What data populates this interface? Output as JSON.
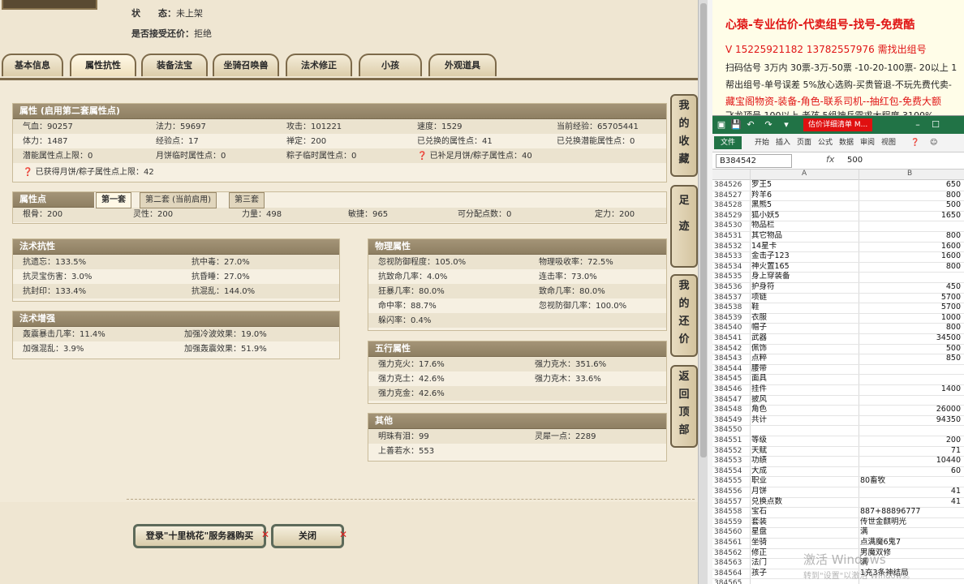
{
  "top": {
    "status_key": "状　　态：",
    "status_val": "未上架",
    "bargain_key": "是否接受还价：",
    "bargain_val": "拒绝"
  },
  "tabs": [
    "基本信息",
    "属性抗性",
    "装备法宝",
    "坐骑召唤兽",
    "法术修正",
    "小孩",
    "外观道具"
  ],
  "attr": {
    "title": "属性 (启用第二套属性点)",
    "rows": [
      [
        "气血：90257",
        "法力：59697",
        "攻击：101221",
        "速度：1529",
        "当前经验：65705441"
      ],
      [
        "体力：1487",
        "经验点：17",
        "禅定：200",
        "已兑换的属性点：41",
        "已兑换潜能属性点：0"
      ],
      [
        "潜能属性点上限：0",
        "月饼临时属性点：0",
        "粽子临时属性点：0",
        "已补足月饼/粽子属性点：40",
        ""
      ]
    ],
    "note": "已获得月饼/粽子属性点上限：42"
  },
  "points": {
    "title": "属性点",
    "subtabs": [
      "第一套",
      "第二套 (当前启用)",
      "第三套"
    ],
    "values": [
      "根骨：200",
      "灵性：200",
      "力量：498",
      "敏捷：965",
      "可分配点数：0",
      "定力：200"
    ]
  },
  "magic_resist": {
    "title": "法术抗性",
    "rows": [
      [
        "抗遗忘：133.5%",
        "抗中毒：27.0%"
      ],
      [
        "抗灵宝伤害：3.0%",
        "抗昏睡：27.0%"
      ],
      [
        "抗封印：133.4%",
        "抗混乱：144.0%"
      ]
    ]
  },
  "magic_boost": {
    "title": "法术增强",
    "rows": [
      [
        "轰震暴击几率：11.4%",
        "加强冷波效果：19.0%"
      ],
      [
        "加强混乱：3.9%",
        "加强轰震效果：51.9%"
      ]
    ]
  },
  "physical": {
    "title": "物理属性",
    "rows": [
      [
        "忽视防御程度：105.0%",
        "物理吸收率：72.5%"
      ],
      [
        "抗致命几率：4.0%",
        "连击率：73.0%"
      ],
      [
        "狂暴几率：80.0%",
        "致命几率：80.0%"
      ],
      [
        "命中率：88.7%",
        "忽视防御几率：100.0%"
      ],
      [
        "躲闪率：0.4%",
        ""
      ]
    ]
  },
  "wuxing": {
    "title": "五行属性",
    "rows": [
      [
        "强力克火：17.6%",
        "强力克水：351.6%"
      ],
      [
        "强力克土：42.6%",
        "强力克木：33.6%"
      ],
      [
        "强力克金：42.6%",
        ""
      ]
    ]
  },
  "other": {
    "title": "其他",
    "rows": [
      [
        "明珠有泪：99",
        "灵犀一点：2289"
      ],
      [
        "上善若水：553",
        ""
      ]
    ]
  },
  "side_buttons": [
    "我的收藏",
    "足迹",
    "我的还价",
    "返回顶部"
  ],
  "buttons": {
    "login": "登录\"十里桃花\"服务器购买",
    "close": "关闭"
  },
  "promo": {
    "line1": "心猿-专业估价-代卖组号-找号-免费酷",
    "line2": "V 15225921182  13782557976 需找出组号",
    "line3": "扫码估号 3万内 30票-3万-50票 -10-20-100票- 20以上 1",
    "line4": "帮出组号-单号误差 5%放心选购-买贵管退-不玩先费代卖-",
    "line5": "藏宝阁物资-装备-角色-联系司机--抽红包-免费大额",
    "line6": "飞龙顶号 100以上 老孩 5组神兵需求大程度 3100%"
  },
  "excel": {
    "title": "估价详细清单 M...",
    "ribbon_tabs": [
      "文件",
      "开始",
      "插入",
      "页面",
      "公式",
      "数据",
      "审阅",
      "视图"
    ],
    "name_box": "B384542",
    "formula": "500",
    "col_a": "A",
    "col_b": "B",
    "rows": [
      [
        "384526",
        "罗王5",
        "650"
      ],
      [
        "384527",
        "羚羊6",
        "800"
      ],
      [
        "384528",
        "黑熊5",
        "500"
      ],
      [
        "384529",
        "狐小妖5",
        "1650"
      ],
      [
        "384530",
        "物品栏",
        ""
      ],
      [
        "384531",
        "其它物品",
        "800"
      ],
      [
        "384532",
        "14星卡",
        "1600"
      ],
      [
        "384533",
        "金击子123",
        "1600"
      ],
      [
        "384534",
        "神火置165",
        "800"
      ],
      [
        "384535",
        "身上穿装备",
        ""
      ],
      [
        "384536",
        "护身符",
        "450"
      ],
      [
        "384537",
        "项链",
        "5700"
      ],
      [
        "384538",
        "鞋",
        "5700"
      ],
      [
        "384539",
        "衣服",
        "1000"
      ],
      [
        "384540",
        "帽子",
        "800"
      ],
      [
        "384541",
        "武器",
        "34500"
      ],
      [
        "384542",
        "佩饰",
        "500"
      ],
      [
        "384543",
        "点粹",
        "850"
      ],
      [
        "384544",
        "腰带",
        ""
      ],
      [
        "384545",
        "面具",
        ""
      ],
      [
        "384546",
        "挂件",
        "1400"
      ],
      [
        "384547",
        "披风",
        ""
      ],
      [
        "384548",
        "角色",
        "26000"
      ],
      [
        "384549",
        "共计",
        "94350"
      ],
      [
        "384550",
        "",
        ""
      ],
      [
        "384551",
        "等级",
        "200"
      ],
      [
        "384552",
        "天赋",
        "71"
      ],
      [
        "384553",
        "功绩",
        "10440"
      ],
      [
        "384554",
        "大成",
        "60"
      ],
      [
        "384555",
        "职业",
        "80畜牧"
      ],
      [
        "384556",
        "月饼",
        "41"
      ],
      [
        "384557",
        "兑换点数",
        "41"
      ],
      [
        "384558",
        "宝石",
        "887+88896777"
      ],
      [
        "384559",
        "套装",
        "传世金麒明光"
      ],
      [
        "384560",
        "星盘",
        "满"
      ],
      [
        "384561",
        "坐骑",
        "点满魔6鬼7"
      ],
      [
        "384562",
        "修正",
        "男魔双修"
      ],
      [
        "384563",
        "法门",
        "满"
      ],
      [
        "384564",
        "孩子",
        "1充3条神结局"
      ],
      [
        "384565",
        "",
        ""
      ]
    ],
    "watermark": "激活 Windows",
    "watermark2": "转到\"设置\"以激活 Windows。"
  }
}
